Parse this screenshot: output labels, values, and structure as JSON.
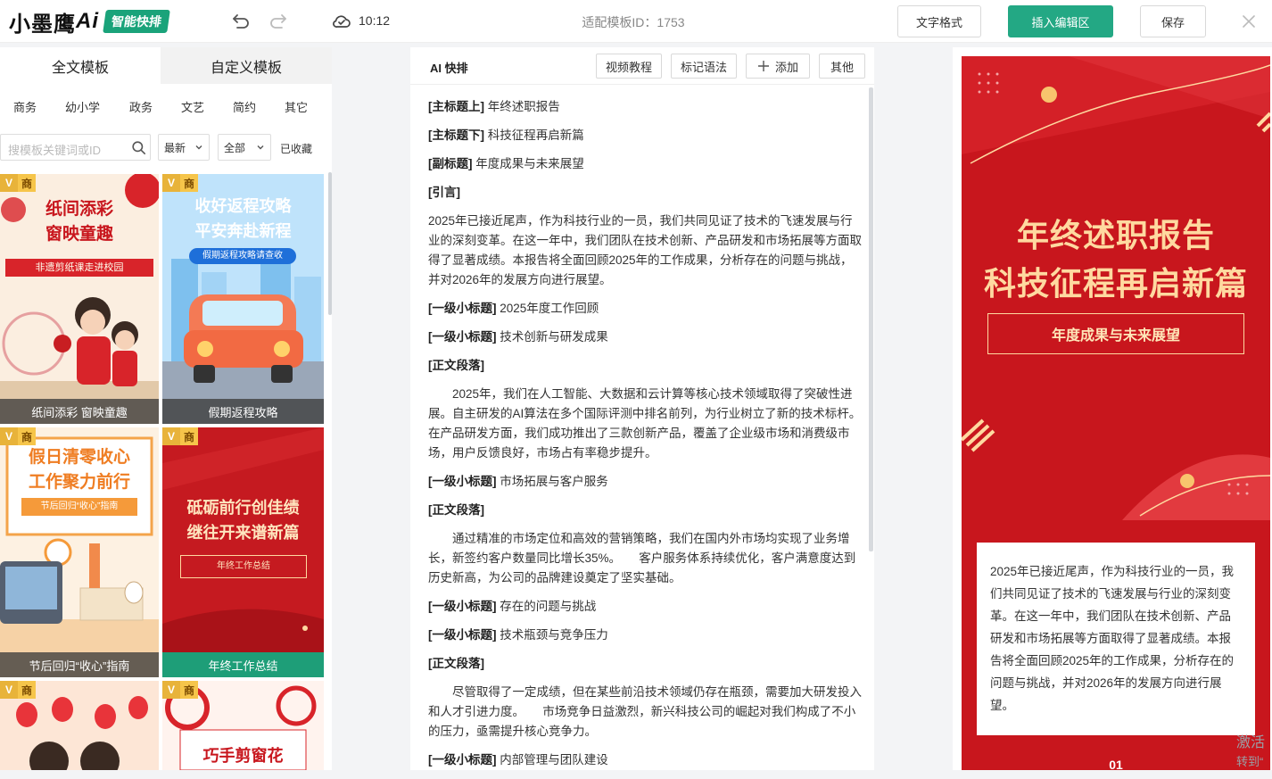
{
  "topbar": {
    "logo_text": "小墨鹰",
    "logo_ai": "Ai",
    "logo_badge": "智能快排",
    "time": "10:12",
    "template_id": "适配模板ID：1753",
    "format_label": "文字格式",
    "insert_label": "插入编辑区",
    "save_label": "保存"
  },
  "left": {
    "tabs": [
      "全文模板",
      "自定义模板"
    ],
    "categories": [
      "商务",
      "幼小学",
      "政务",
      "文艺",
      "简约",
      "其它"
    ],
    "search_placeholder": "搜模板关键词或ID",
    "sort_select": "最新",
    "filter_select": "全部",
    "favorites": "已收藏",
    "vip_v": "V",
    "vip_s": "商",
    "cards": [
      {
        "title_lines": [
          "纸间添彩",
          "窗映童趣"
        ],
        "banner": "非遗剪纸课走进校园",
        "caption": "纸间添彩 窗映童趣"
      },
      {
        "title_lines": [
          "收好返程攻略",
          "平安奔赴新程"
        ],
        "banner": "假期返程攻略请查收",
        "caption": "假期返程攻略"
      },
      {
        "title_lines": [
          "假日清零收心",
          "工作聚力前行"
        ],
        "banner": "节后回归“收心”指南",
        "caption": "节后回归“收心”指南"
      },
      {
        "title_lines": [
          "砥砺前行创佳绩",
          "继往开来谱新篇"
        ],
        "banner": "年终工作总结",
        "caption": "年终工作总结"
      },
      {
        "title_lines": [],
        "banner": "",
        "caption": ""
      },
      {
        "title_lines": [
          "巧手剪窗花"
        ],
        "banner": "",
        "caption": ""
      }
    ]
  },
  "editor": {
    "title": "AI 快排",
    "buttons": {
      "tutorial": "视频教程",
      "syntax": "标记语法",
      "add": "添加",
      "other": "其他"
    },
    "lines": [
      {
        "tag": "[主标题上]",
        "text": " 年终述职报告"
      },
      {
        "tag": "[主标题下]",
        "text": " 科技征程再启新篇"
      },
      {
        "tag": "[副标题]",
        "text": " 年度成果与未来展望"
      },
      {
        "tag": "[引言]",
        "text": ""
      }
    ],
    "intro": "2025年已接近尾声，作为科技行业的一员，我们共同见证了技术的飞速发展与行业的深刻变革。在这一年中，我们团队在技术创新、产品研发和市场拓展等方面取得了显著成绩。本报告将全面回顾2025年的工作成果，分析存在的问题与挑战，并对2026年的发展方向进行展望。",
    "lines2": [
      {
        "tag": "[一级小标题]",
        "text": " 2025年度工作回顾"
      },
      {
        "tag": "[一级小标题]",
        "text": " 技术创新与研发成果"
      },
      {
        "tag": "[正文段落]",
        "text": ""
      }
    ],
    "para1": "　　2025年，我们在人工智能、大数据和云计算等核心技术领域取得了突破性进展。自主研发的AI算法在多个国际评测中排名前列，为行业树立了新的技术标杆。　　在产品研发方面，我们成功推出了三款创新产品，覆盖了企业级市场和消费级市场，用户反馈良好，市场占有率稳步提升。",
    "lines3": [
      {
        "tag": "[一级小标题]",
        "text": " 市场拓展与客户服务"
      },
      {
        "tag": "[正文段落]",
        "text": ""
      }
    ],
    "para2": "　　通过精准的市场定位和高效的营销策略，我们在国内外市场均实现了业务增长，新签约客户数量同比增长35%。　　客户服务体系持续优化，客户满意度达到历史新高，为公司的品牌建设奠定了坚实基础。",
    "lines4": [
      {
        "tag": "[一级小标题]",
        "text": " 存在的问题与挑战"
      },
      {
        "tag": "[一级小标题]",
        "text": " 技术瓶颈与竞争压力"
      },
      {
        "tag": "[正文段落]",
        "text": ""
      }
    ],
    "para3": "　　尽管取得了一定成绩，但在某些前沿技术领域仍存在瓶颈，需要加大研发投入和人才引进力度。　　市场竞争日益激烈，新兴科技公司的崛起对我们构成了不小的压力，亟需提升核心竞争力。",
    "lines5": [
      {
        "tag": "[一级小标题]",
        "text": " 内部管理与团队建设"
      }
    ]
  },
  "preview": {
    "title_line1": "年终述职报告",
    "title_line2": "科技征程再启新篇",
    "subtitle": "年度成果与未来展望",
    "body": "2025年已接近尾声，作为科技行业的一员，我们共同见证了技术的飞速发展与行业的深刻变革。在这一年中，我们团队在技术创新、产品研发和市场拓展等方面取得了显著成绩。本报告将全面回顾2025年的工作成果，分析存在的问题与挑战，并对2026年的发展方向进行展望。",
    "section_number": "01"
  },
  "watermark": {
    "line1": "激活",
    "line2": "转到“"
  },
  "colors": {
    "brand_green": "#23a884",
    "poster_red": "#c8161d",
    "poster_gold": "#ffd9a0"
  }
}
